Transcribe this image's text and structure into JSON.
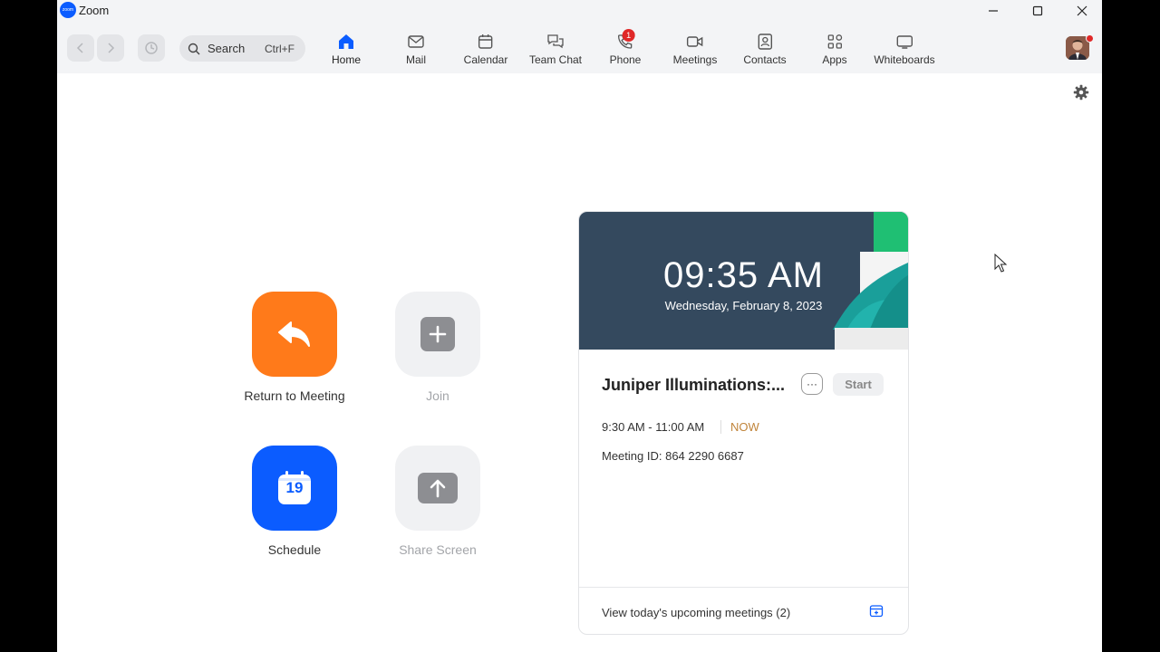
{
  "window": {
    "title": "Zoom",
    "logo_text": "zoom"
  },
  "toolbar": {
    "search_label": "Search",
    "search_shortcut": "Ctrl+F",
    "tabs": [
      {
        "label": "Home",
        "icon": "home-icon",
        "active": true
      },
      {
        "label": "Mail",
        "icon": "mail-icon"
      },
      {
        "label": "Calendar",
        "icon": "calendar-icon"
      },
      {
        "label": "Team Chat",
        "icon": "chat-icon"
      },
      {
        "label": "Phone",
        "icon": "phone-icon",
        "badge": "1"
      },
      {
        "label": "Meetings",
        "icon": "video-icon"
      },
      {
        "label": "Contacts",
        "icon": "contacts-icon"
      },
      {
        "label": "Apps",
        "icon": "apps-icon"
      },
      {
        "label": "Whiteboards",
        "icon": "whiteboard-icon"
      }
    ]
  },
  "actions": {
    "return_label": "Return to Meeting",
    "join_label": "Join",
    "schedule_label": "Schedule",
    "schedule_day": "19",
    "share_label": "Share Screen"
  },
  "card": {
    "time": "09:35 AM",
    "date": "Wednesday, February 8, 2023",
    "meeting_title": "Juniper Illuminations:...",
    "more_label": "···",
    "start_label": "Start",
    "meeting_time": "9:30 AM - 11:00 AM",
    "now_label": "NOW",
    "meeting_id": "Meeting ID: 864 2290 6687",
    "footer_text": "View today's upcoming meetings (2)"
  },
  "colors": {
    "accent_blue": "#0b5cff",
    "return_orange": "#ff7a1a",
    "hero_bg": "#34495e",
    "badge_red": "#e02828"
  }
}
